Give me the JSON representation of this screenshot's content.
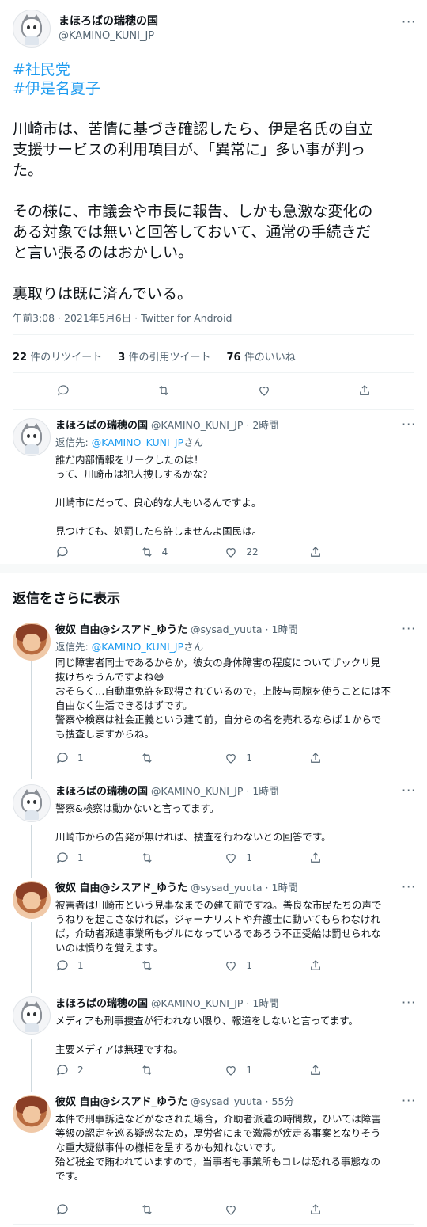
{
  "main_tweet": {
    "name": "まほろばの瑞穂の国",
    "handle": "@KAMINO_KUNI_JP",
    "hashtags": [
      "#社民党",
      "#伊是名夏子"
    ],
    "body": "川崎市は、苦情に基づき確認したら、伊是名氏の自立\n支援サービスの利用項目が、「異常に」多い事が判っ\nた。\n\nその様に、市議会や市長に報告、しかも急激な変化の\nある対象では無いと回答しておいて、通常の手続きだ\nと言い張るのはおかしい。\n\n裏取りは既に済んでいる。",
    "meta": "午前3:08 · 2021年5月6日 · Twitter for Android",
    "stats": {
      "retweets_num": "22",
      "retweets_label": "件のリツイート",
      "quotes_num": "3",
      "quotes_label": "件の引用ツイート",
      "likes_num": "76",
      "likes_label": "件のいいね"
    }
  },
  "section_title": "返信をさらに表示",
  "replies": [
    {
      "name": "まほろばの瑞穂の国",
      "handle_time": "@KAMINO_KUNI_JP · 2時間",
      "reply_to_prefix": "返信先: ",
      "reply_to_handle": "@KAMINO_KUNI_JP",
      "reply_to_suffix": "さん",
      "text": "誰だ内部情報をリークしたのは！\nって、川崎市は犯人捜しするかな？\n\n川崎市にだって、良心的な人もいるんですよ。\n\n見つけても、処罰したら許しませんよ国民は。",
      "retweets": "4",
      "likes": "22"
    },
    {
      "name": "彼奴 自由@シスアド_ゆうた",
      "handle_time": "@sysad_yuuta · 1時間",
      "reply_to_prefix": "返信先: ",
      "reply_to_handle": "@KAMINO_KUNI_JP",
      "reply_to_suffix": "さん",
      "text": "同じ障害者同士であるからか，彼女の身体障害の程度についてザックリ見\n抜けちゃうんですよね😅\nおそらく…自動車免許を取得されているので，上肢与両腕を使うことには不\n自由なく生活できるはずです。\n警察や検察は社会正義という建て前，自分らの名を売れるならば１からで\nも捜査しますからね。",
      "replies": "1",
      "likes": "1"
    },
    {
      "name": "まほろばの瑞穂の国",
      "handle_time": "@KAMINO_KUNI_JP · 1時間",
      "text": "警察&検察は動かないと言ってます。\n\n川崎市からの告発が無ければ、捜査を行わないとの回答です。",
      "replies": "1",
      "likes": "1"
    },
    {
      "name": "彼奴 自由@シスアド_ゆうた",
      "handle_time": "@sysad_yuuta · 1時間",
      "text": "被害者は川崎市という見事なまでの建て前ですね。善良な市民たちの声で\nうねりを起こさなければ，ジャーナリストや弁護士に動いてもらわなけれ\nば，介助者派遣事業所もグルになっているであろう不正受給は罰せられな\nいのは憤りを覚えます。",
      "replies": "1",
      "likes": "1"
    },
    {
      "name": "まほろばの瑞穂の国",
      "handle_time": "@KAMINO_KUNI_JP · 1時間",
      "text": "メディアも刑事捜査が行われない限り、報道をしないと言ってます。\n\n主要メディアは無理ですね。",
      "replies": "2",
      "likes": "1"
    },
    {
      "name": "彼奴 自由@シスアド_ゆうた",
      "handle_time": "@sysad_yuuta · 55分",
      "text": "本件で刑事訴追などがなされた場合，介助者派遣の時間数，ひいては障害\n等級の認定を巡る疑惑なため，厚労省にまで激震が疾走る事案となりそう\nな重大疑獄事件の様相を呈するかも知れないです。\n殆ど税金で賄われていますので，当事者も事業所もコレは恐れる事態なの\nです。"
    }
  ]
}
